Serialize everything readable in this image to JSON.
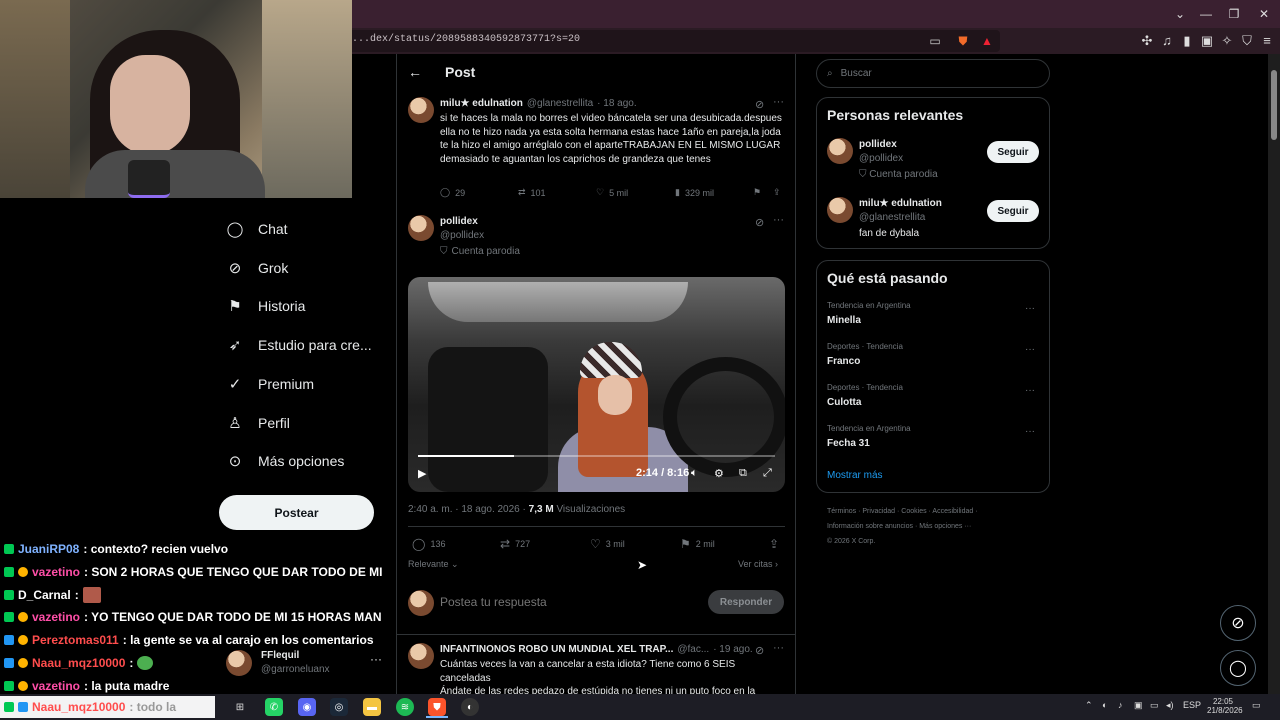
{
  "browser": {
    "url": "...dex/status/2089588340592873771?s=20",
    "controls": {
      "minimize": "⌄",
      "restore": "—",
      "maximize": "❐",
      "close": "✕"
    }
  },
  "nav": {
    "items": [
      {
        "label": "Chat",
        "icon": "chat-bubble-icon"
      },
      {
        "label": "Grok",
        "icon": "grok-icon"
      },
      {
        "label": "Historia",
        "icon": "bookmark-icon"
      },
      {
        "label": "Estudio para cre...",
        "icon": "rocket-icon"
      },
      {
        "label": "Premium",
        "icon": "premium-icon"
      },
      {
        "label": "Perfil",
        "icon": "person-icon"
      },
      {
        "label": "Más opciones",
        "icon": "more-circle-icon"
      }
    ],
    "post_button": "Postear",
    "profile": {
      "name": "FFlequil",
      "handle": "@garroneluanx"
    }
  },
  "chat": [
    {
      "user": "JuaniRP08",
      "color": "#7fb2ff",
      "message": ": contexto? recien vuelvo"
    },
    {
      "user": "vazetino",
      "color": "#ff4fa8",
      "message": ": SON 2 HORAS QUE TENGO QUE DAR TODO DE MI"
    },
    {
      "user": "D_Carnal",
      "color": "#ffffff",
      "message": ":"
    },
    {
      "user": "vazetino",
      "color": "#ff4fa8",
      "message": ": YO TENGO QUE DAR TODO DE MI 15 HORAS MAN"
    },
    {
      "user": "Pereztomas011",
      "color": "#ff4d4d",
      "message": ": la gente se va al carajo en los comentarios"
    },
    {
      "user": "Naau_mqz10000",
      "color": "#ff4d4d",
      "message": ":"
    },
    {
      "user": "vazetino",
      "color": "#ff4fa8",
      "message": ": la puta madre"
    },
    {
      "user": "Naau_mqz10000",
      "color": "#ff4d4d",
      "message": ": todo la"
    }
  ],
  "main": {
    "header_title": "Post",
    "reply_tweet": {
      "name": "milu★ edulnation",
      "handle": "@glanestrellita",
      "date": "· 18 ago.",
      "text": "si te haces la mala no borres el video báncatela ser una desubicada.despues ella no te hizo nada ya esta solta hermana estas hace 1año en pareja,la joda te la hizo el amigo arréglalo con el aparteTRABAJAN EN EL MISMO LUGAR demasiado te aguantan los caprichos de grandeza que tenes",
      "replies": "29",
      "retweets": "101",
      "likes": "5 mil",
      "views": "329 mil"
    },
    "main_tweet": {
      "name": "pollidex",
      "handle": "@pollidex",
      "label": "Cuenta parodia",
      "video_time": "2:14 / 8:16",
      "video_progress": 0.27,
      "timestamp": "2:40 a. m. · 18 ago. 2026 ·",
      "views": "7,3 M",
      "views_label": "Visualizaciones",
      "replies": "136",
      "retweets": "727",
      "likes": "3 mil",
      "bookmarks": "2 mil"
    },
    "sort_label": "Relevante",
    "quotes_label": "Ver citas",
    "reply_placeholder": "Postea tu respuesta",
    "reply_button": "Responder",
    "next_tweet": {
      "name": "INFANTINONOS ROBO UN MUNDIAL XEL TRAP...",
      "handle": "@fac...",
      "date": "· 19 ago.",
      "text": "Cuántas veces la van a cancelar a esta idiota? Tiene como 6 SEIS canceladas",
      "text2": "Ándate de las redes pedazo de estúpida no tienes ni un puto foco en la"
    }
  },
  "sidebar": {
    "search_placeholder": "Buscar",
    "relevant_title": "Personas relevantes",
    "people": [
      {
        "name": "pollidex",
        "handle": "@pollidex",
        "bio": "Cuenta parodia",
        "button": "Seguir"
      },
      {
        "name": "milu★ edulnation",
        "handle": "@glanestrellita",
        "bio": "fan de dybala",
        "button": "Seguir"
      }
    ],
    "trends_title": "Qué está pasando",
    "trends": [
      {
        "meta": "Tendencia en Argentina",
        "name": "Minella"
      },
      {
        "meta": "Deportes · Tendencia",
        "name": "Franco"
      },
      {
        "meta": "Deportes · Tendencia",
        "name": "Culotta"
      },
      {
        "meta": "Tendencia en Argentina",
        "name": "Fecha 31"
      }
    ],
    "show_more": "Mostrar más",
    "footer_line1": "Términos  ·  Privacidad  ·  Cookies  ·  Accesibilidad  ·",
    "footer_line2": "Información sobre anuncios  ·  Más opciones ···",
    "footer_line3": "© 2026 X Corp."
  },
  "taskbar": {
    "lang": "ESP",
    "time": "22:05",
    "date": "21/8/2026"
  },
  "colors": {
    "accent": "#1d9bf0",
    "background": "#000000",
    "border": "#2f3336",
    "muted": "#71767b"
  }
}
